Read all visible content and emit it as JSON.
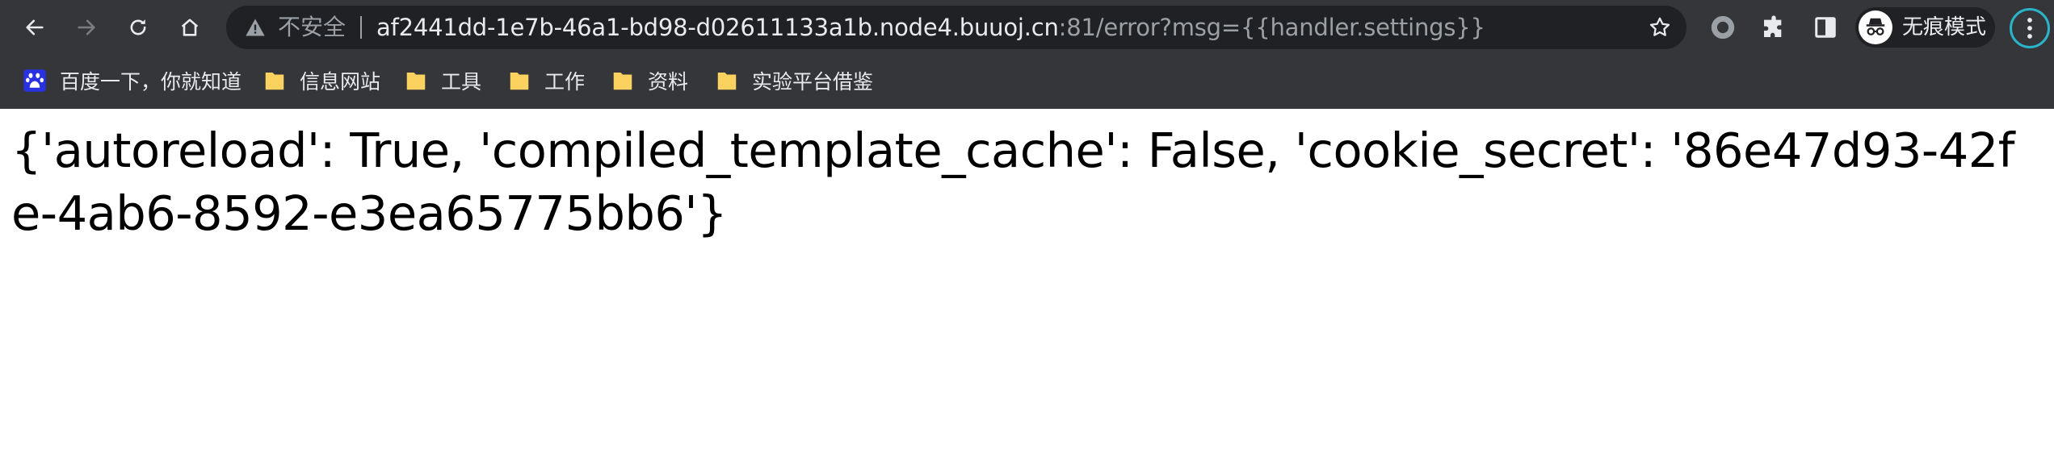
{
  "browser": {
    "url": {
      "insecure_label": "不安全",
      "host": "af2441dd-1e7b-46a1-bd98-d02611133a1b.node4.buuoj.cn",
      "rest": ":81/error?msg={{handler.settings}}"
    },
    "profile_label": "无痕模式",
    "colors": {
      "frame": "#35363a",
      "omnibox": "#202124",
      "text_primary": "#e8eaed",
      "text_secondary": "#9aa0a6",
      "folder": "#fbd25f",
      "menu_ring": "#2bb3c9"
    }
  },
  "bookmarks": [
    {
      "label": "百度一下，你就知道",
      "icon": "baidu-paw-icon"
    },
    {
      "label": "信息网站",
      "icon": "folder-icon"
    },
    {
      "label": "工具",
      "icon": "folder-icon"
    },
    {
      "label": "工作",
      "icon": "folder-icon"
    },
    {
      "label": "资料",
      "icon": "folder-icon"
    },
    {
      "label": "实验平台借鉴",
      "icon": "folder-icon"
    }
  ],
  "page": {
    "body_text": "{'autoreload': True, 'compiled_template_cache': False, 'cookie_secret': '86e47d93-42fe-4ab6-8592-e3ea65775bb6'}"
  }
}
